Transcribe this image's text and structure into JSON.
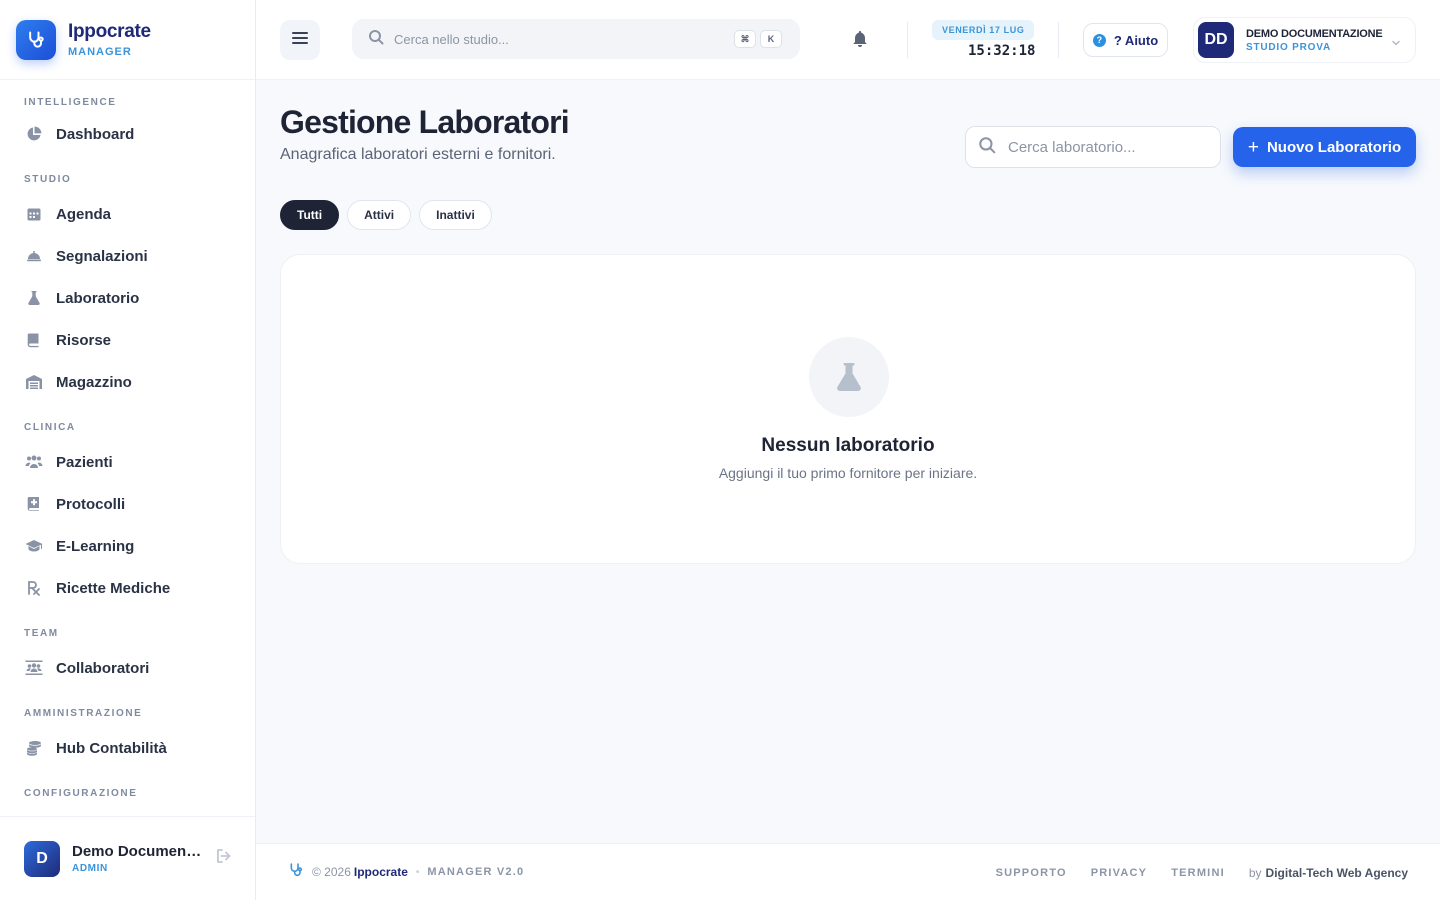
{
  "brand": {
    "name": "Ippocrate",
    "sub": "MANAGER"
  },
  "sidebar": {
    "sections": [
      {
        "title": "INTELLIGENCE",
        "items": [
          {
            "label": "Dashboard",
            "icon": "pie-chart-icon"
          }
        ]
      },
      {
        "title": "STUDIO",
        "items": [
          {
            "label": "Agenda",
            "icon": "calendar-icon"
          },
          {
            "label": "Segnalazioni",
            "icon": "bell-service-icon"
          },
          {
            "label": "Laboratorio",
            "icon": "flask-icon"
          },
          {
            "label": "Risorse",
            "icon": "book-icon"
          },
          {
            "label": "Magazzino",
            "icon": "warehouse-icon"
          }
        ]
      },
      {
        "title": "CLINICA",
        "items": [
          {
            "label": "Pazienti",
            "icon": "users-icon"
          },
          {
            "label": "Protocolli",
            "icon": "medical-book-icon"
          },
          {
            "label": "E-Learning",
            "icon": "graduation-cap-icon"
          },
          {
            "label": "Ricette Mediche",
            "icon": "prescription-icon"
          }
        ]
      },
      {
        "title": "TEAM",
        "items": [
          {
            "label": "Collaboratori",
            "icon": "people-group-icon"
          }
        ]
      },
      {
        "title": "AMMINISTRAZIONE",
        "items": [
          {
            "label": "Hub Contabilità",
            "icon": "coins-icon"
          }
        ]
      },
      {
        "title": "CONFIGURAZIONE",
        "items": []
      }
    ],
    "user": {
      "initial": "D",
      "name": "Demo Documentazione",
      "role": "ADMIN"
    }
  },
  "topbar": {
    "search_placeholder": "Cerca nello studio...",
    "kbd": [
      "⌘",
      "K"
    ],
    "date": "VENERDÌ 17 LUG",
    "time": "15:32:18",
    "help_label": "? Aiuto",
    "user": {
      "initials": "DD",
      "name": "DEMO DOCUMENTAZIONE",
      "org": "STUDIO PROVA"
    }
  },
  "main": {
    "title": "Gestione Laboratori",
    "subtitle": "Anagrafica laboratori esterni e fornitori.",
    "search_placeholder": "Cerca laboratorio...",
    "new_button": "Nuovo Laboratorio",
    "filters": [
      "Tutti",
      "Attivi",
      "Inattivi"
    ],
    "active_filter": "Tutti",
    "empty_title": "Nessun laboratorio",
    "empty_sub": "Aggiungi il tuo primo fornitore per iniziare."
  },
  "footer": {
    "copyright": "© 2026",
    "brand": "Ippocrate",
    "version": "MANAGER V2.0",
    "links": [
      "SUPPORTO",
      "PRIVACY",
      "TERMINI"
    ],
    "by": "by",
    "agency": "Digital-Tech Web Agency"
  },
  "colors": {
    "accent": "#2563eb",
    "brand_navy": "#1e2a78",
    "brand_light": "#3b94d9"
  }
}
